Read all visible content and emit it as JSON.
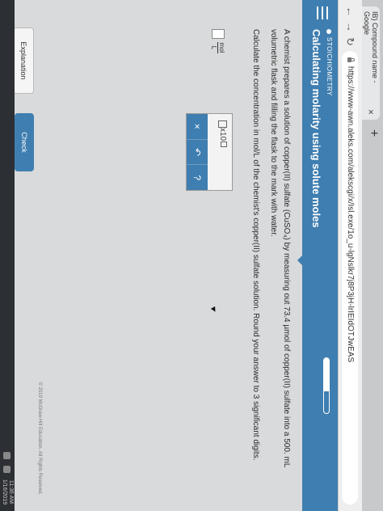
{
  "browser": {
    "tab_title": "IB) Compound name - Google",
    "tab_close": "×",
    "new_tab": "+",
    "url": "https://www-awn.aleks.com/alekscgi/x/Isl.exe/1o_u-lgNslkr7j8P3jH-lrIEIdOTJwEAS"
  },
  "aleks": {
    "topic": "STOICHIOMETRY",
    "title": "Calculating molarity using solute moles",
    "progress_fraction": 0.6
  },
  "question": {
    "line1": "A chemist prepares a solution of copper(II) sulfate (CuSO₄) by measuring out 73.4 µmol of copper(II) sulfate into a 500. mL volumetric flask and filling the flask to the mark with water.",
    "line2": "Calculate the concentration in mol/L of the chemist's copper(II) sulfate solution. Round your answer to 3 significant digits."
  },
  "answer": {
    "unit_top": "mol",
    "unit_bottom": "L",
    "sci_base": "x10"
  },
  "tools": {
    "clear": "×",
    "undo": "↶",
    "help": "?"
  },
  "footer": {
    "explanation": "Explanation",
    "check": "Check",
    "copyright": "© 2019 McGraw-Hill Education. All Rights Reserved."
  },
  "taskbar": {
    "time": "11:36 AM",
    "date": "1/16/2019"
  },
  "colors": {
    "accent": "#3f7eb0"
  }
}
